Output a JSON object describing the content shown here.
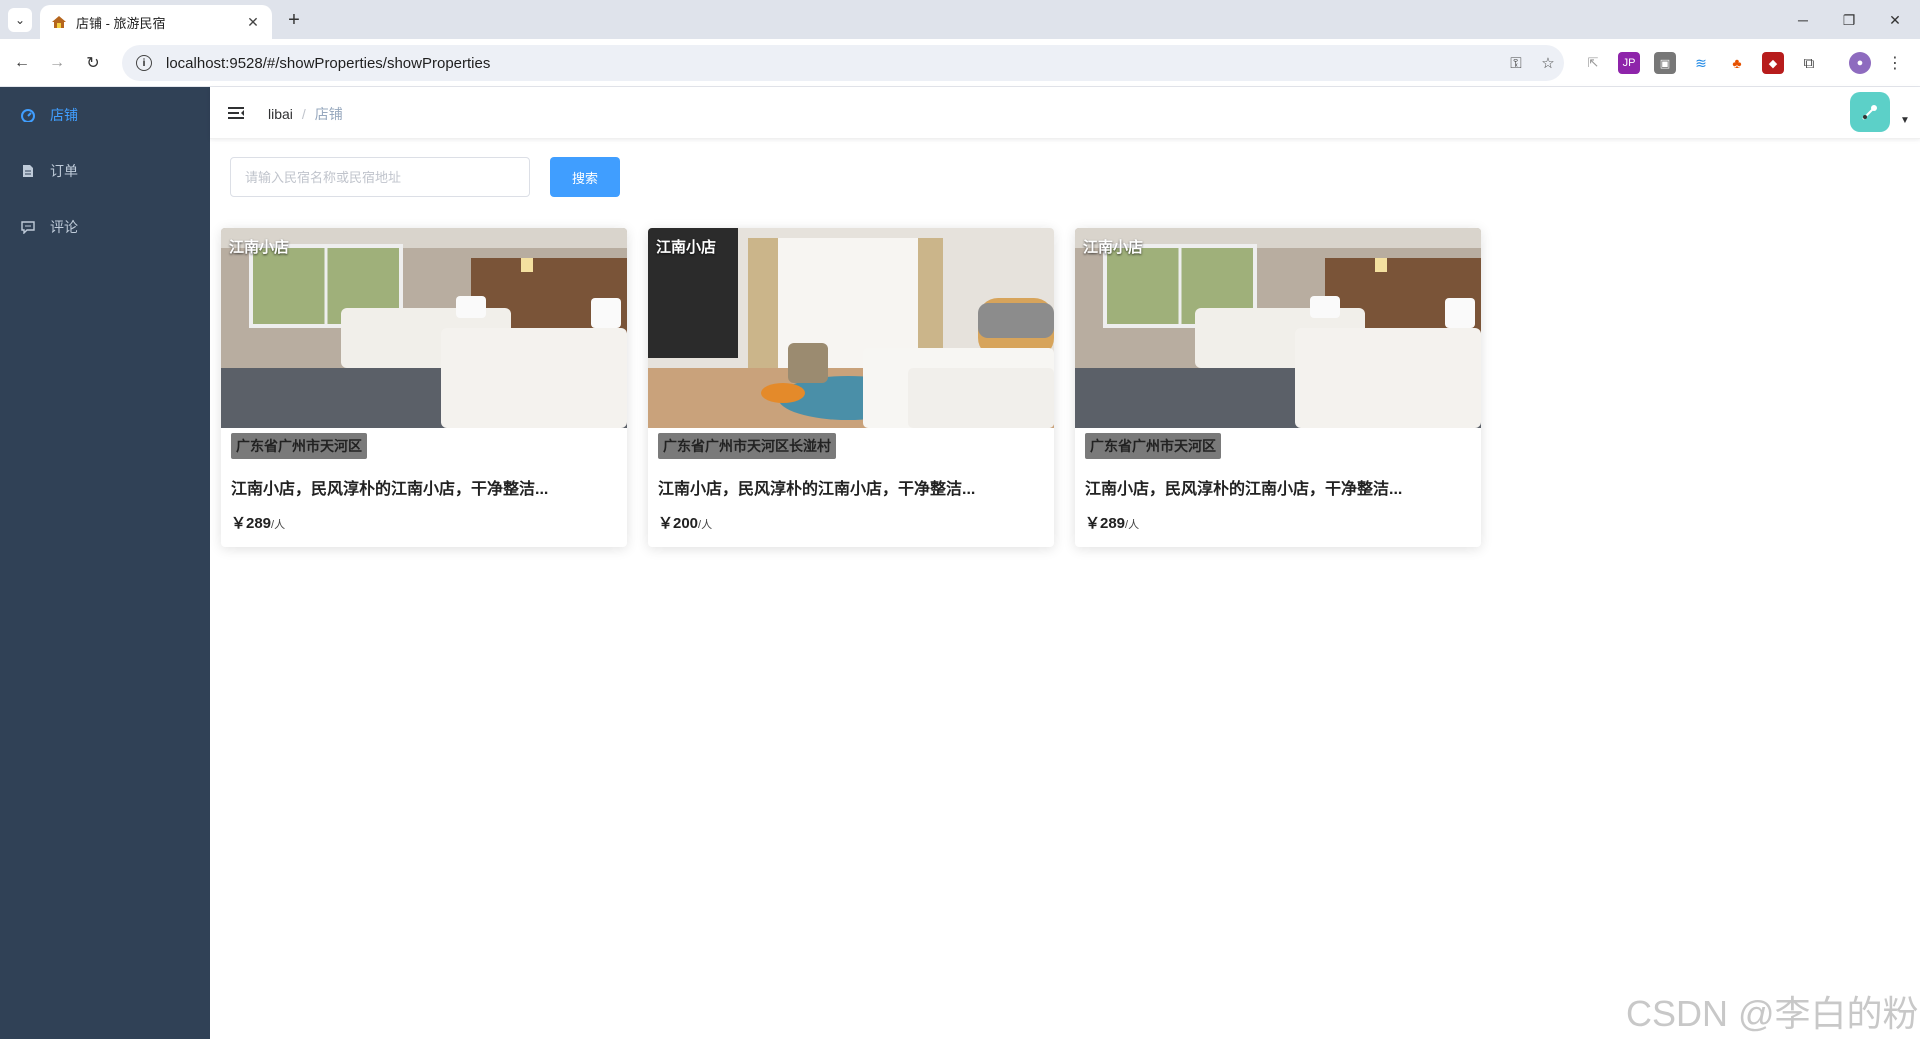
{
  "browser": {
    "tab_title": "店铺 - 旅游民宿",
    "url": "localhost:9528/#/showProperties/showProperties"
  },
  "sidebar": {
    "items": [
      {
        "label": "店铺",
        "icon": "dashboard-icon",
        "active": true
      },
      {
        "label": "订单",
        "icon": "document-icon",
        "active": false
      },
      {
        "label": "评论",
        "icon": "comment-icon",
        "active": false
      }
    ]
  },
  "navbar": {
    "breadcrumb": [
      "libai",
      "店铺"
    ]
  },
  "search": {
    "placeholder": "请输入民宿名称或民宿地址",
    "button_label": "搜索"
  },
  "cards": [
    {
      "name": "江南小店",
      "address": "广东省广州市天河区",
      "description": "江南小店，民风淳朴的江南小店，干净整洁...",
      "price": "￥289",
      "unit": "/人"
    },
    {
      "name": "江南小店",
      "address": "广东省广州市天河区长湴村",
      "description": "江南小店，民风淳朴的江南小店，干净整洁...",
      "price": "￥200",
      "unit": "/人"
    },
    {
      "name": "江南小店",
      "address": "广东省广州市天河区",
      "description": "江南小店，民风淳朴的江南小店，干净整洁...",
      "price": "￥289",
      "unit": "/人"
    }
  ],
  "watermark": "CSDN @李白的粉",
  "colors": {
    "sidebar_bg": "#304156",
    "accent": "#409eff",
    "avatar_bg": "#5cd0c8"
  }
}
